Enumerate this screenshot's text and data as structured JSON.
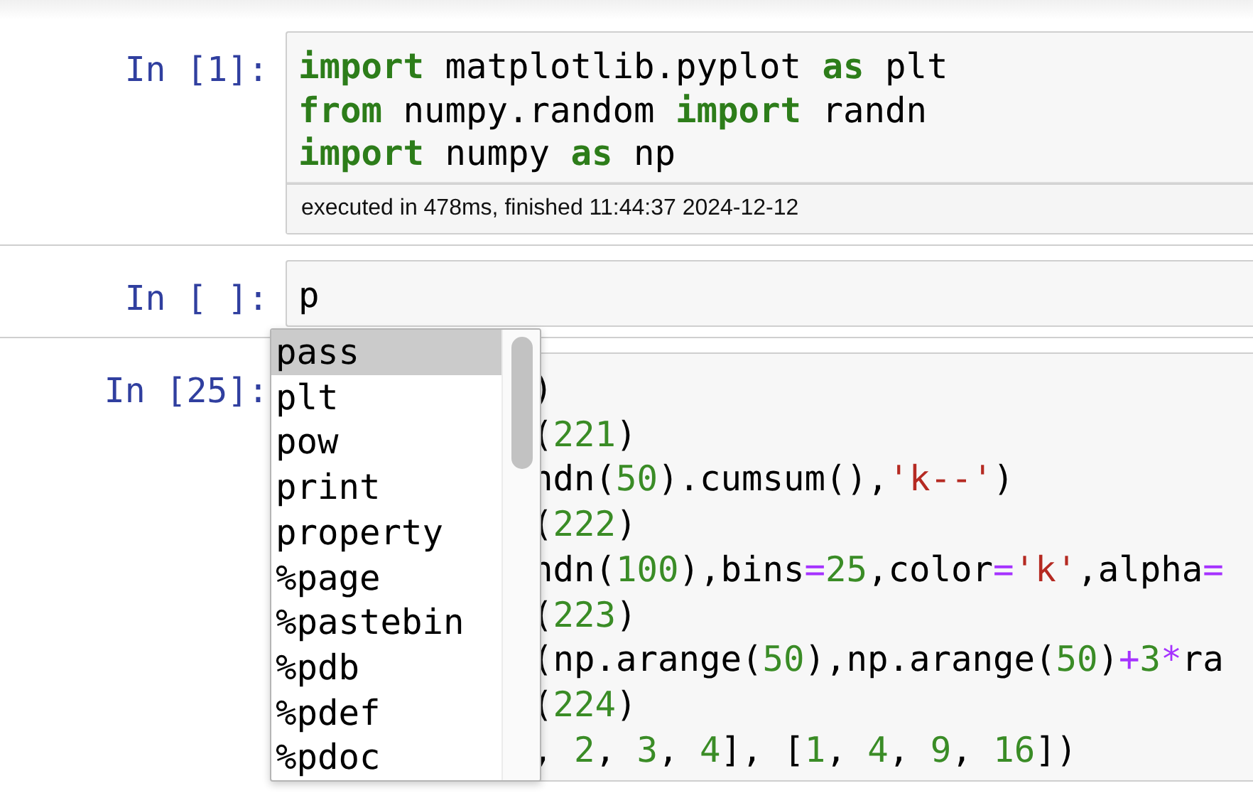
{
  "cells": [
    {
      "prompt": "In [1]:",
      "covered": false,
      "lines": [
        [
          {
            "text": "import",
            "kind": "keyword"
          },
          {
            "text": " matplotlib.pyplot ",
            "kind": "plain"
          },
          {
            "text": "as",
            "kind": "keyword"
          },
          {
            "text": " plt",
            "kind": "plain"
          }
        ],
        [
          {
            "text": "from",
            "kind": "keyword"
          },
          {
            "text": " numpy.random ",
            "kind": "plain"
          },
          {
            "text": "import",
            "kind": "keyword"
          },
          {
            "text": " randn",
            "kind": "plain"
          }
        ],
        [
          {
            "text": "import",
            "kind": "keyword"
          },
          {
            "text": " numpy ",
            "kind": "plain"
          },
          {
            "text": "as",
            "kind": "keyword"
          },
          {
            "text": " np",
            "kind": "plain"
          }
        ]
      ],
      "execution_info": "executed in 478ms, finished 11:44:37 2024-12-12"
    },
    {
      "prompt": "In [ ]:",
      "covered": false,
      "lines": [
        [
          {
            "text": "p",
            "kind": "plain"
          }
        ]
      ]
    },
    {
      "prompt": "In [25]:",
      "covered": true,
      "lines": [
        [
          {
            "text": ")",
            "kind": "plain"
          }
        ],
        [
          {
            "text": "(",
            "kind": "plain"
          },
          {
            "text": "221",
            "kind": "number"
          },
          {
            "text": ")",
            "kind": "plain"
          }
        ],
        [
          {
            "text": "ndn(",
            "kind": "plain"
          },
          {
            "text": "50",
            "kind": "number"
          },
          {
            "text": ").cumsum(),",
            "kind": "plain"
          },
          {
            "text": "'k--'",
            "kind": "string"
          },
          {
            "text": ")",
            "kind": "plain"
          }
        ],
        [
          {
            "text": "(",
            "kind": "plain"
          },
          {
            "text": "222",
            "kind": "number"
          },
          {
            "text": ")",
            "kind": "plain"
          }
        ],
        [
          {
            "text": "ndn(",
            "kind": "plain"
          },
          {
            "text": "100",
            "kind": "number"
          },
          {
            "text": "),bins",
            "kind": "plain"
          },
          {
            "text": "=",
            "kind": "operator"
          },
          {
            "text": "25",
            "kind": "number"
          },
          {
            "text": ",color",
            "kind": "plain"
          },
          {
            "text": "=",
            "kind": "operator"
          },
          {
            "text": "'k'",
            "kind": "string"
          },
          {
            "text": ",alpha",
            "kind": "plain"
          },
          {
            "text": "=",
            "kind": "operator"
          }
        ],
        [
          {
            "text": "(",
            "kind": "plain"
          },
          {
            "text": "223",
            "kind": "number"
          },
          {
            "text": ")",
            "kind": "plain"
          }
        ],
        [
          {
            "text": "(np.arange(",
            "kind": "plain"
          },
          {
            "text": "50",
            "kind": "number"
          },
          {
            "text": "),np.arange(",
            "kind": "plain"
          },
          {
            "text": "50",
            "kind": "number"
          },
          {
            "text": ")",
            "kind": "plain"
          },
          {
            "text": "+",
            "kind": "operator"
          },
          {
            "text": "3",
            "kind": "number"
          },
          {
            "text": "*",
            "kind": "operator"
          },
          {
            "text": "ra",
            "kind": "plain"
          }
        ],
        [
          {
            "text": "(",
            "kind": "plain"
          },
          {
            "text": "224",
            "kind": "number"
          },
          {
            "text": ")",
            "kind": "plain"
          }
        ],
        [
          {
            "text": ", ",
            "kind": "plain"
          },
          {
            "text": "2",
            "kind": "number"
          },
          {
            "text": ", ",
            "kind": "plain"
          },
          {
            "text": "3",
            "kind": "number"
          },
          {
            "text": ", ",
            "kind": "plain"
          },
          {
            "text": "4",
            "kind": "number"
          },
          {
            "text": "], [",
            "kind": "plain"
          },
          {
            "text": "1",
            "kind": "number"
          },
          {
            "text": ", ",
            "kind": "plain"
          },
          {
            "text": "4",
            "kind": "number"
          },
          {
            "text": ", ",
            "kind": "plain"
          },
          {
            "text": "9",
            "kind": "number"
          },
          {
            "text": ", ",
            "kind": "plain"
          },
          {
            "text": "16",
            "kind": "number"
          },
          {
            "text": "])",
            "kind": "plain"
          }
        ]
      ]
    }
  ],
  "completion_popup": {
    "items": [
      {
        "label": "pass",
        "selected": true
      },
      {
        "label": "plt",
        "selected": false
      },
      {
        "label": "pow",
        "selected": false
      },
      {
        "label": "print",
        "selected": false
      },
      {
        "label": "property",
        "selected": false
      },
      {
        "label": "%page",
        "selected": false
      },
      {
        "label": "%pastebin",
        "selected": false
      },
      {
        "label": "%pdb",
        "selected": false
      },
      {
        "label": "%pdef",
        "selected": false
      },
      {
        "label": "%pdoc",
        "selected": false
      }
    ]
  }
}
